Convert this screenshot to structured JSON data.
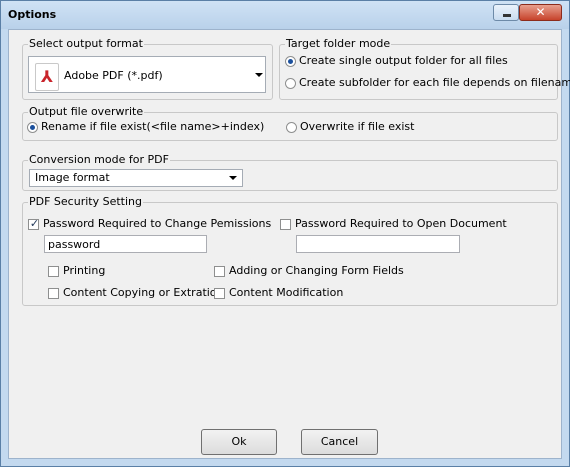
{
  "window": {
    "title": "Options",
    "close_glyph": "✕"
  },
  "output_format": {
    "label": "Select output format",
    "selected": "Adobe PDF (*.pdf)",
    "icon": "pdf-icon"
  },
  "target_folder": {
    "label": "Target folder mode",
    "options": [
      {
        "label": "Create single output folder for all files",
        "checked": true
      },
      {
        "label": "Create subfolder for each file depends on filename",
        "checked": false
      }
    ]
  },
  "overwrite": {
    "label": "Output file overwrite",
    "options": [
      {
        "label": "Rename if file exist(<file name>+index)",
        "checked": true
      },
      {
        "label": "Overwrite if file exist",
        "checked": false
      }
    ]
  },
  "conversion_mode": {
    "label": "Conversion mode for PDF",
    "selected": "Image format"
  },
  "security": {
    "label": "PDF Security Setting",
    "change_perm": {
      "label": "Password Required to Change Pemissions",
      "checked": true,
      "value": "password"
    },
    "open_doc": {
      "label": "Password Required to Open Document",
      "checked": false,
      "value": ""
    },
    "permissions": [
      {
        "label": "Printing",
        "checked": false
      },
      {
        "label": "Adding or Changing Form Fields",
        "checked": false
      },
      {
        "label": "Content Copying or Extration",
        "checked": false
      },
      {
        "label": "Content Modification",
        "checked": false
      }
    ],
    "check_glyph": "✓"
  },
  "buttons": {
    "ok": "Ok",
    "cancel": "Cancel"
  }
}
